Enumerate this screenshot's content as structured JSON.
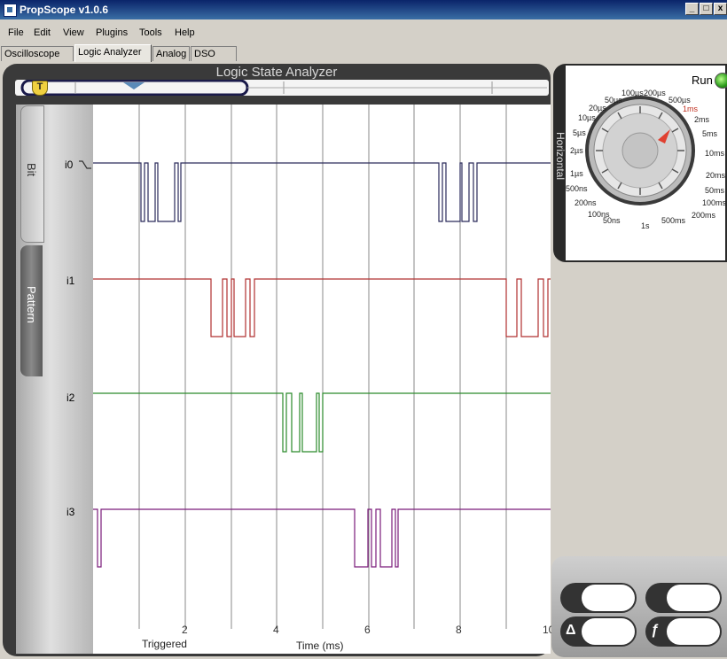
{
  "window": {
    "title": "PropScope v1.0.6",
    "buttons": [
      "_",
      "□",
      "x"
    ]
  },
  "menu": [
    "File",
    "Edit",
    "View",
    "Plugins",
    "Tools",
    "Help"
  ],
  "tabs": [
    {
      "label": "Oscilloscope",
      "active": false
    },
    {
      "label": "Logic Analyzer",
      "active": true
    },
    {
      "label": "Analog",
      "active": false
    },
    {
      "label": "DSO LSA",
      "active": false
    }
  ],
  "panel": {
    "title": "Logic State Analyzer",
    "trigger_marker": "T"
  },
  "side_tabs": {
    "bit": "Bit",
    "pattern": "Pattern"
  },
  "channels": [
    {
      "label": "i0",
      "color": "#2a2a5a"
    },
    {
      "label": "i1",
      "color": "#b03030"
    },
    {
      "label": "i2",
      "color": "#2a8a2a"
    },
    {
      "label": "i3",
      "color": "#7a1a7a"
    }
  ],
  "x_axis": {
    "ticks": [
      "2",
      "4",
      "6",
      "8",
      "10"
    ],
    "label": "Time (ms)",
    "trigger_label": "Triggered"
  },
  "horizontal": {
    "side_label": "Horizontal",
    "run_label": "Run",
    "dial_labels": [
      "50µs",
      "100µs",
      "200µs",
      "500µs",
      "20µs",
      "10µs",
      "5µs",
      "2µs",
      "1µs",
      "500ns",
      "200ns",
      "100ns",
      "50ns",
      "1s",
      "500ms",
      "200ms",
      "100ms",
      "50ms",
      "20ms",
      "10ms",
      "5ms",
      "2ms",
      "1ms"
    ],
    "selected": "1ms"
  },
  "bottom_buttons": [
    {
      "symbol": ""
    },
    {
      "symbol": ""
    },
    {
      "symbol": "Δ"
    },
    {
      "symbol": "ƒ"
    }
  ]
}
